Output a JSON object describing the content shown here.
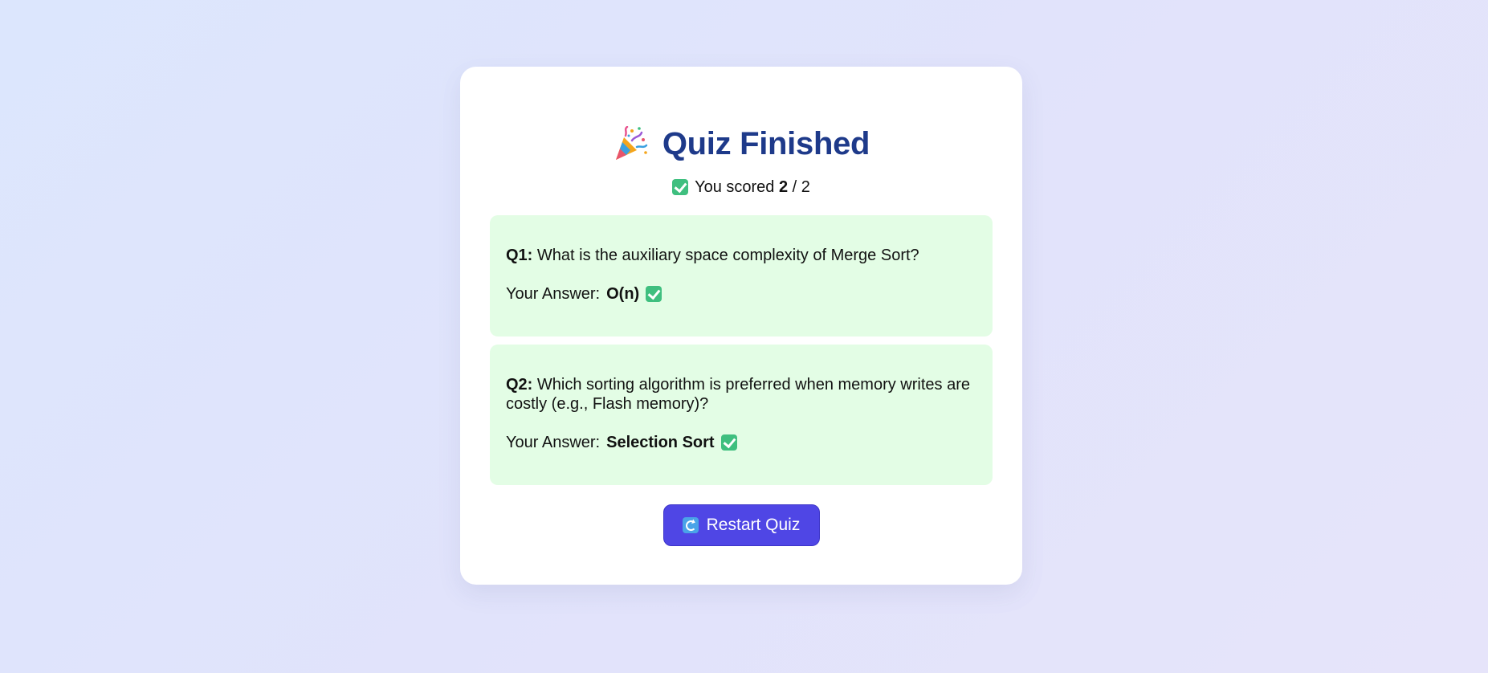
{
  "result": {
    "title": "Quiz Finished",
    "score_prefix": "You scored",
    "score_value": "2",
    "score_total": " / 2"
  },
  "questions": [
    {
      "label": "Q1:",
      "text": " What is the auxiliary space complexity of Merge Sort?",
      "answer_prefix": "Your Answer:",
      "answer": "O(n)"
    },
    {
      "label": "Q2:",
      "text": " Which sorting algorithm is preferred when memory writes are costly (e.g., Flash memory)?",
      "answer_prefix": "Your Answer:",
      "answer": "Selection Sort"
    }
  ],
  "actions": {
    "restart_label": "Restart Quiz"
  },
  "icons": {
    "title_icon": "party-popper-icon",
    "correct_icon": "check-mark-icon",
    "restart_icon": "refresh-icon"
  },
  "colors": {
    "title": "#1e3a8a",
    "question_card_bg": "#e3fde5",
    "button_bg": "#4f46e5",
    "check": "#3fbf7f"
  }
}
